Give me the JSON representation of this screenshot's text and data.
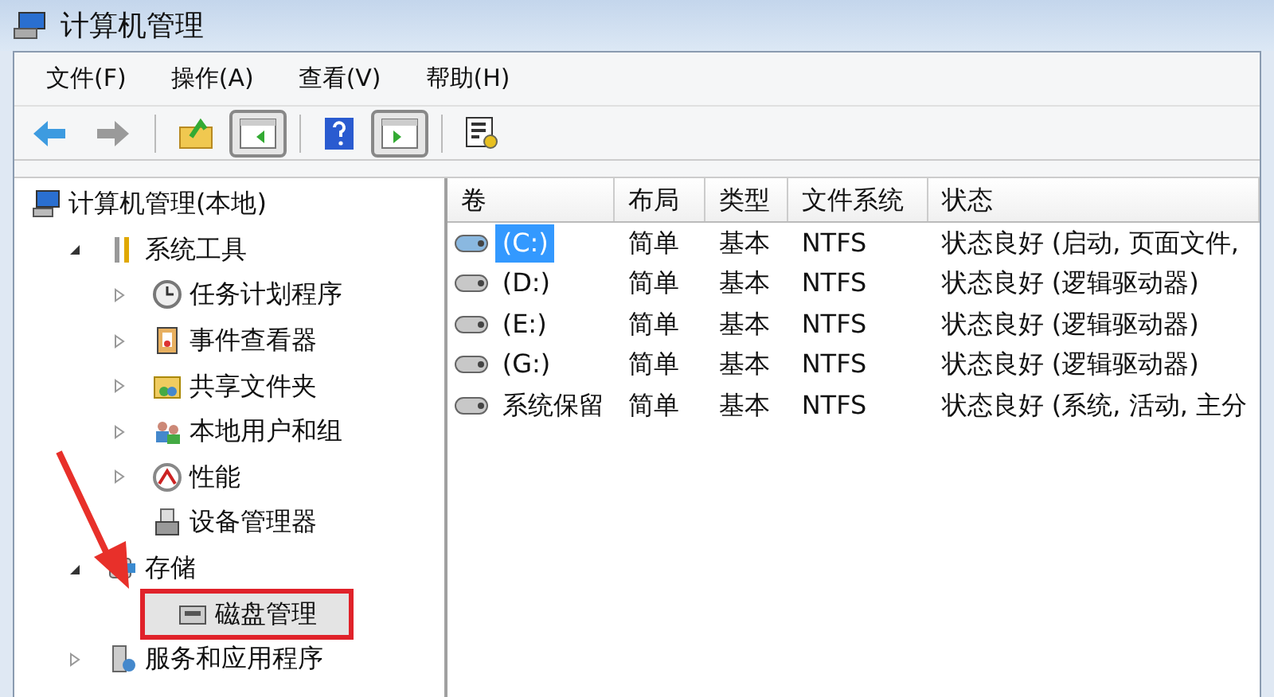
{
  "window": {
    "title": "计算机管理"
  },
  "menu": [
    "文件(F)",
    "操作(A)",
    "查看(V)",
    "帮助(H)"
  ],
  "toolbar": [
    {
      "pressed": false
    },
    {
      "pressed": false
    },
    {
      "pressed": false
    },
    {
      "pressed": true
    },
    {
      "pressed": false
    },
    {
      "pressed": true
    },
    {
      "pressed": false
    }
  ],
  "tree": {
    "label": "计算机管理(本地)",
    "children": [
      {
        "label": "系统工具",
        "expanded": true,
        "children": [
          {
            "label": "任务计划程序",
            "expanded": false
          },
          {
            "label": "事件查看器",
            "expanded": false
          },
          {
            "label": "共享文件夹",
            "expanded": false
          },
          {
            "label": "本地用户和组",
            "expanded": false
          },
          {
            "label": "性能",
            "expanded": false
          },
          {
            "label": "设备管理器",
            "selected": false,
            "highlighted": false
          }
        ]
      },
      {
        "label": "存储",
        "expanded": true,
        "children": [
          {
            "label": "磁盘管理",
            "selected": true,
            "highlighted": true
          }
        ]
      },
      {
        "label": "服务和应用程序",
        "expanded": false
      }
    ]
  },
  "table": {
    "columns": [
      "卷",
      "布局",
      "类型",
      "文件系统",
      "状态"
    ],
    "rows": [
      {
        "cells": [
          "(C:)",
          "简单",
          "基本",
          "NTFS",
          "状态良好 (启动, 页面文件,"
        ],
        "selected": true
      },
      {
        "cells": [
          "(D:)",
          "简单",
          "基本",
          "NTFS",
          "状态良好 (逻辑驱动器)"
        ],
        "selected": false
      },
      {
        "cells": [
          "(E:)",
          "简单",
          "基本",
          "NTFS",
          "状态良好 (逻辑驱动器)"
        ],
        "selected": false
      },
      {
        "cells": [
          "(G:)",
          "简单",
          "基本",
          "NTFS",
          "状态良好 (逻辑驱动器)"
        ],
        "selected": false
      },
      {
        "cells": [
          "系统保留",
          "简单",
          "基本",
          "NTFS",
          "状态良好 (系统, 活动, 主分"
        ],
        "selected": false
      }
    ]
  }
}
